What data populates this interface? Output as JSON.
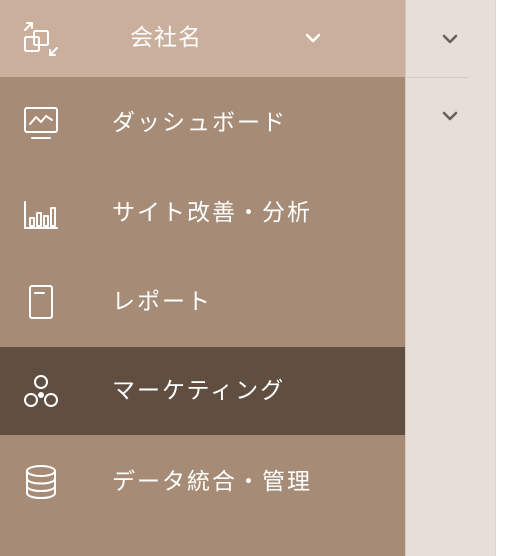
{
  "company": {
    "name": "会社名",
    "logo_icon": "switch-company-icon",
    "chevron_icon": "chevron-down-icon"
  },
  "nav": {
    "items": [
      {
        "label": "ダッシュボード",
        "icon": "dashboard-monitor-icon",
        "active": false
      },
      {
        "label": "サイト改善・分析",
        "icon": "bar-chart-icon",
        "active": false
      },
      {
        "label": "レポート",
        "icon": "report-document-icon",
        "active": false
      },
      {
        "label": "マーケティング",
        "icon": "marketing-nodes-icon",
        "active": true
      },
      {
        "label": "データ統合・管理",
        "icon": "database-icon",
        "active": false
      }
    ]
  },
  "subpanel": {
    "chevrons": [
      "chevron-down-icon",
      "chevron-down-icon"
    ]
  },
  "colors": {
    "sidebar": "#a68b76",
    "company_bar": "#c9af9c",
    "active_item": "#604f40",
    "subpanel": "#e6ded9",
    "text": "#ffffff"
  }
}
